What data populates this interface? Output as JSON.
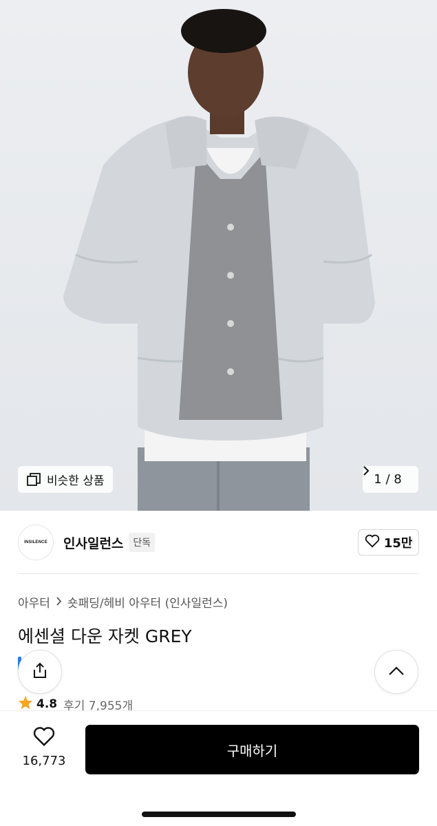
{
  "hero": {
    "similar_label": "비슷한 상품",
    "pager": "1 / 8",
    "image_icon": "person-wearing-puffer-jacket"
  },
  "brand": {
    "logo_text": "INSILENCE",
    "name": "인사일런스",
    "badge": "단독",
    "like_count": "15만"
  },
  "breadcrumb": {
    "items": [
      "아우터",
      "숏패딩/헤비 아우터 (인사일런스)"
    ]
  },
  "product": {
    "title": "에센셜 다운 자켓 GREY",
    "rating": "4.8",
    "reviews": "후기 7,955개"
  },
  "bottom": {
    "heart_count": "16,773",
    "buy_label": "구매하기"
  },
  "colors": {
    "buy_button": "#000000",
    "star": "#f5a623",
    "accent_blue": "#2b7de9"
  }
}
